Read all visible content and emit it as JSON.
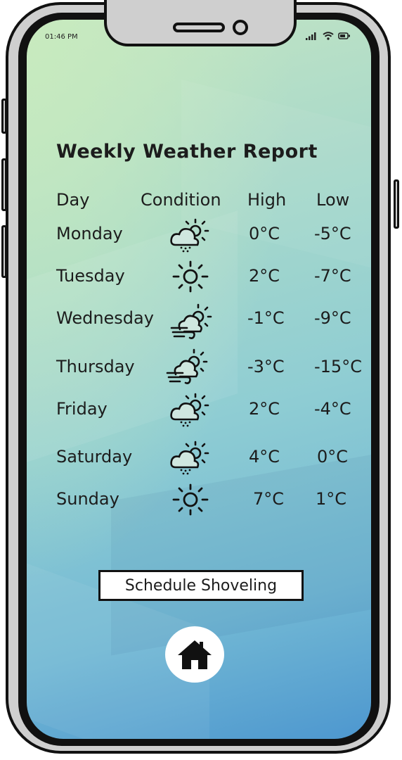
{
  "status_bar": {
    "time": "01:46 PM"
  },
  "report": {
    "title": "Weekly Weather Report",
    "headers": {
      "day": "Day",
      "condition": "Condition",
      "high": "High",
      "low": "Low"
    },
    "rows": [
      {
        "day": "Monday",
        "condition_icon": "snow-cloud-sun-icon",
        "high": "0°C",
        "low": "-5°C"
      },
      {
        "day": "Tuesday",
        "condition_icon": "sun-icon",
        "high": "2°C",
        "low": "-7°C"
      },
      {
        "day": "Wednesday",
        "condition_icon": "wind-cloud-sun-icon",
        "high": "-1°C",
        "low": "-9°C"
      },
      {
        "day": "Thursday",
        "condition_icon": "wind-cloud-sun-icon",
        "high": "-3°C",
        "low": "-15°C"
      },
      {
        "day": "Friday",
        "condition_icon": "snow-cloud-sun-icon",
        "high": "2°C",
        "low": "-4°C"
      },
      {
        "day": "Saturday",
        "condition_icon": "snow-cloud-sun-icon",
        "high": "4°C",
        "low": "0°C"
      },
      {
        "day": "Sunday",
        "condition_icon": "sun-icon",
        "high": "7°C",
        "low": "1°C"
      }
    ]
  },
  "actions": {
    "schedule_label": "Schedule Shoveling",
    "home_icon": "home-icon"
  }
}
